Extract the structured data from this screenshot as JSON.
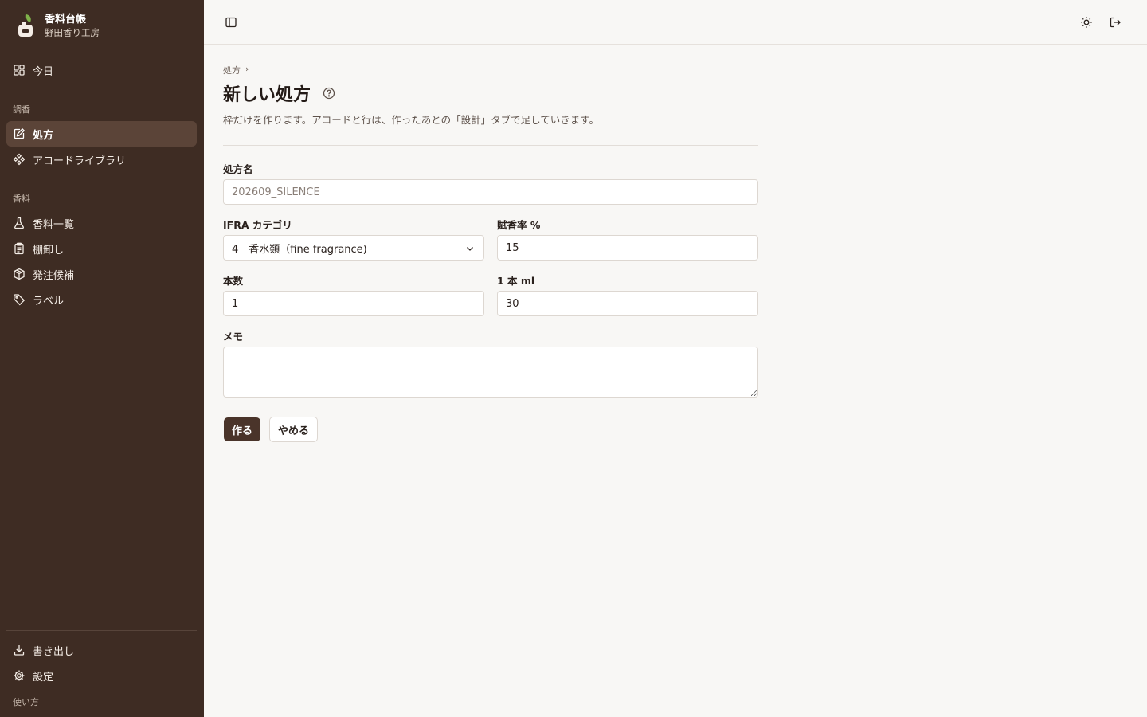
{
  "brand": {
    "title": "香料台帳",
    "subtitle": "野田香り工房"
  },
  "sidebar": {
    "today": "今日",
    "section_blend": "調香",
    "blend_items": [
      "処方",
      "アコードライブラリ"
    ],
    "section_materials": "香料",
    "material_items": [
      "香料一覧",
      "棚卸し",
      "発注候補",
      "ラベル"
    ],
    "bottom_items": [
      "書き出し",
      "設定"
    ],
    "help": "使い方"
  },
  "header": {
    "sidebar_toggle": "sidebar-toggle-icon",
    "theme": "sun-icon",
    "logout": "logout-icon"
  },
  "page": {
    "breadcrumb": "処方",
    "breadcrumb_sep": "›",
    "title": "新しい処方",
    "description": "枠だけを作ります。アコードと行は、作ったあとの「設計」タブで足していきます。"
  },
  "form": {
    "name_label": "処方名",
    "name_placeholder": "202609_SILENCE",
    "ifra_label": "IFRA カテゴリ",
    "ifra_value": "4　香水類（fine fragrance)",
    "rate_label": "賦香率 %",
    "rate_value": "15",
    "count_label": "本数",
    "count_value": "1",
    "ml_label": "1 本 ml",
    "ml_value": "30",
    "memo_label": "メモ",
    "memo_value": ""
  },
  "actions": {
    "create": "作る",
    "cancel": "やめる"
  },
  "colors": {
    "sidebar_bg": "#3e2c23",
    "active_bg": "#5b4438",
    "primary": "#4a342a",
    "brand_leaf": "#7fb24a"
  }
}
